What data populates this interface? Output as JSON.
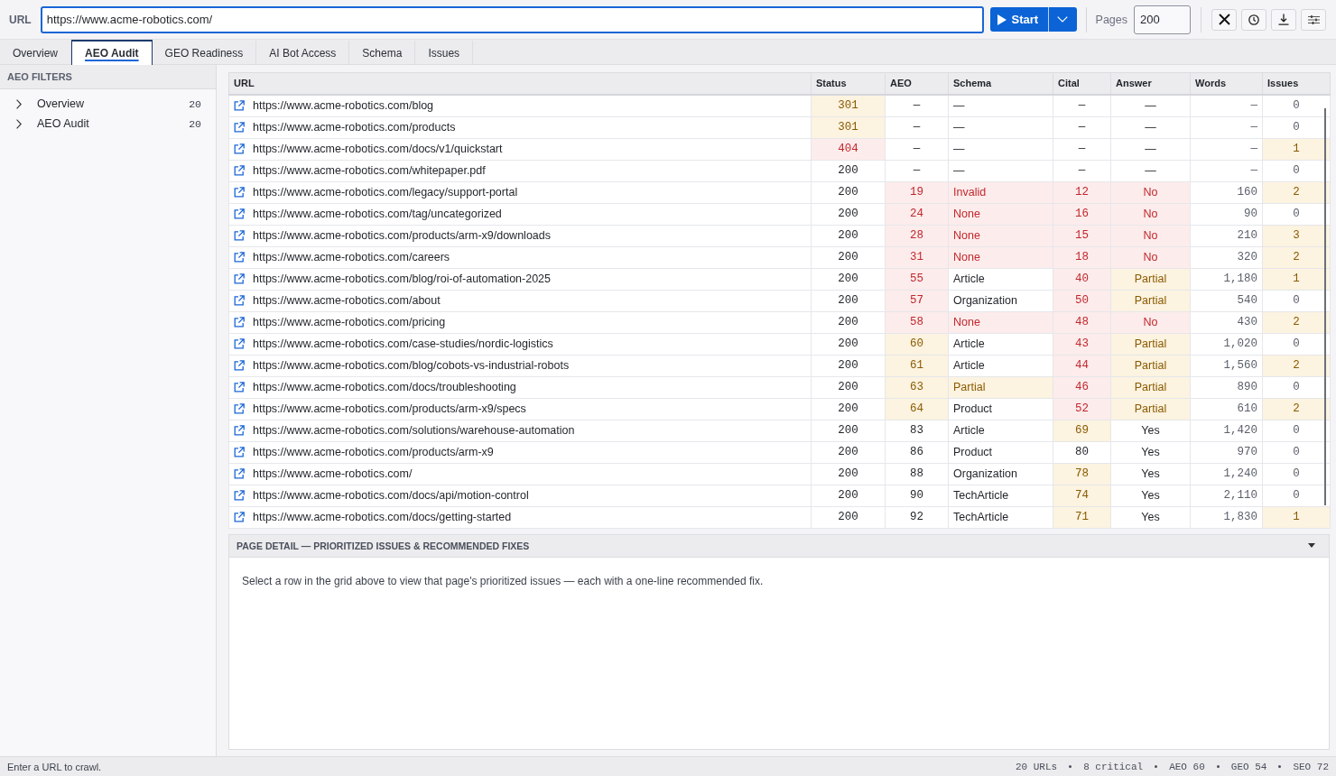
{
  "toolbar": {
    "url_label": "URL",
    "url": "https://www.acme-robotics.com/",
    "start_button": "Start",
    "pages_label": "Pages",
    "pages_value": "200"
  },
  "tabs": [
    {
      "label": "Overview",
      "selected": false
    },
    {
      "label": "AEO Audit",
      "selected": true
    },
    {
      "label": "GEO Readiness",
      "selected": false
    },
    {
      "label": "AI Bot Access",
      "selected": false
    },
    {
      "label": "Schema",
      "selected": false
    },
    {
      "label": "Issues",
      "selected": false
    }
  ],
  "sidebar": {
    "title": "AEO FILTERS",
    "items": [
      {
        "label": "Overview",
        "count": "20",
        "expanded": false
      },
      {
        "label": "AEO Audit",
        "count": "20",
        "expanded": false
      }
    ]
  },
  "table": {
    "columns": [
      "URL",
      "Status",
      "AEO",
      "Schema",
      "Cital",
      "Answer",
      "Words",
      "Issues"
    ],
    "rows": [
      {
        "cells": [
          {
            "text": "https://www.acme-robotics.com/blog",
            "kind": "plain"
          },
          {
            "text": "301",
            "kind": "warning"
          },
          {
            "text": "—",
            "kind": "plain"
          },
          {
            "text": "—",
            "kind": "plain"
          },
          {
            "text": "—",
            "kind": "plain"
          },
          {
            "text": "—",
            "kind": "plain"
          },
          {
            "text": "—",
            "kind": "plain"
          },
          {
            "text": "0",
            "kind": "plain"
          }
        ]
      },
      {
        "cells": [
          {
            "text": "https://www.acme-robotics.com/products",
            "kind": "plain"
          },
          {
            "text": "301",
            "kind": "warning"
          },
          {
            "text": "—",
            "kind": "plain"
          },
          {
            "text": "—",
            "kind": "plain"
          },
          {
            "text": "—",
            "kind": "plain"
          },
          {
            "text": "—",
            "kind": "plain"
          },
          {
            "text": "—",
            "kind": "plain"
          },
          {
            "text": "0",
            "kind": "plain"
          }
        ]
      },
      {
        "cells": [
          {
            "text": "https://www.acme-robotics.com/docs/v1/quickstart",
            "kind": "plain"
          },
          {
            "text": "404",
            "kind": "critical"
          },
          {
            "text": "—",
            "kind": "plain"
          },
          {
            "text": "—",
            "kind": "plain"
          },
          {
            "text": "—",
            "kind": "plain"
          },
          {
            "text": "—",
            "kind": "plain"
          },
          {
            "text": "—",
            "kind": "plain"
          },
          {
            "text": "1",
            "kind": "warning"
          }
        ]
      },
      {
        "cells": [
          {
            "text": "https://www.acme-robotics.com/whitepaper.pdf",
            "kind": "plain"
          },
          {
            "text": "200",
            "kind": "plain"
          },
          {
            "text": "—",
            "kind": "plain"
          },
          {
            "text": "—",
            "kind": "plain"
          },
          {
            "text": "—",
            "kind": "plain"
          },
          {
            "text": "—",
            "kind": "plain"
          },
          {
            "text": "—",
            "kind": "plain"
          },
          {
            "text": "0",
            "kind": "plain"
          }
        ]
      },
      {
        "cells": [
          {
            "text": "https://www.acme-robotics.com/legacy/support-portal",
            "kind": "plain"
          },
          {
            "text": "200",
            "kind": "plain"
          },
          {
            "text": "19",
            "kind": "critical"
          },
          {
            "text": "Invalid",
            "kind": "critical"
          },
          {
            "text": "12",
            "kind": "critical"
          },
          {
            "text": "No",
            "kind": "critical"
          },
          {
            "text": "160",
            "kind": "plain"
          },
          {
            "text": "2",
            "kind": "warning"
          }
        ]
      },
      {
        "cells": [
          {
            "text": "https://www.acme-robotics.com/tag/uncategorized",
            "kind": "plain"
          },
          {
            "text": "200",
            "kind": "plain"
          },
          {
            "text": "24",
            "kind": "critical"
          },
          {
            "text": "None",
            "kind": "critical"
          },
          {
            "text": "16",
            "kind": "critical"
          },
          {
            "text": "No",
            "kind": "critical"
          },
          {
            "text": "90",
            "kind": "plain"
          },
          {
            "text": "0",
            "kind": "plain"
          }
        ]
      },
      {
        "cells": [
          {
            "text": "https://www.acme-robotics.com/products/arm-x9/downloads",
            "kind": "plain"
          },
          {
            "text": "200",
            "kind": "plain"
          },
          {
            "text": "28",
            "kind": "critical"
          },
          {
            "text": "None",
            "kind": "critical"
          },
          {
            "text": "15",
            "kind": "critical"
          },
          {
            "text": "No",
            "kind": "critical"
          },
          {
            "text": "210",
            "kind": "plain"
          },
          {
            "text": "3",
            "kind": "warning"
          }
        ]
      },
      {
        "cells": [
          {
            "text": "https://www.acme-robotics.com/careers",
            "kind": "plain"
          },
          {
            "text": "200",
            "kind": "plain"
          },
          {
            "text": "31",
            "kind": "critical"
          },
          {
            "text": "None",
            "kind": "critical"
          },
          {
            "text": "18",
            "kind": "critical"
          },
          {
            "text": "No",
            "kind": "critical"
          },
          {
            "text": "320",
            "kind": "plain"
          },
          {
            "text": "2",
            "kind": "warning"
          }
        ]
      },
      {
        "cells": [
          {
            "text": "https://www.acme-robotics.com/blog/roi-of-automation-2025",
            "kind": "plain"
          },
          {
            "text": "200",
            "kind": "plain"
          },
          {
            "text": "55",
            "kind": "critical"
          },
          {
            "text": "Article",
            "kind": "plain"
          },
          {
            "text": "40",
            "kind": "critical"
          },
          {
            "text": "Partial",
            "kind": "warning"
          },
          {
            "text": "1,180",
            "kind": "plain"
          },
          {
            "text": "1",
            "kind": "warning"
          }
        ]
      },
      {
        "cells": [
          {
            "text": "https://www.acme-robotics.com/about",
            "kind": "plain"
          },
          {
            "text": "200",
            "kind": "plain"
          },
          {
            "text": "57",
            "kind": "critical"
          },
          {
            "text": "Organization",
            "kind": "plain"
          },
          {
            "text": "50",
            "kind": "critical"
          },
          {
            "text": "Partial",
            "kind": "warning"
          },
          {
            "text": "540",
            "kind": "plain"
          },
          {
            "text": "0",
            "kind": "plain"
          }
        ]
      },
      {
        "cells": [
          {
            "text": "https://www.acme-robotics.com/pricing",
            "kind": "plain"
          },
          {
            "text": "200",
            "kind": "plain"
          },
          {
            "text": "58",
            "kind": "critical"
          },
          {
            "text": "None",
            "kind": "critical"
          },
          {
            "text": "48",
            "kind": "critical"
          },
          {
            "text": "No",
            "kind": "critical"
          },
          {
            "text": "430",
            "kind": "plain"
          },
          {
            "text": "2",
            "kind": "warning"
          }
        ]
      },
      {
        "cells": [
          {
            "text": "https://www.acme-robotics.com/case-studies/nordic-logistics",
            "kind": "plain"
          },
          {
            "text": "200",
            "kind": "plain"
          },
          {
            "text": "60",
            "kind": "warning"
          },
          {
            "text": "Article",
            "kind": "plain"
          },
          {
            "text": "43",
            "kind": "critical"
          },
          {
            "text": "Partial",
            "kind": "warning"
          },
          {
            "text": "1,020",
            "kind": "plain"
          },
          {
            "text": "0",
            "kind": "plain"
          }
        ]
      },
      {
        "cells": [
          {
            "text": "https://www.acme-robotics.com/blog/cobots-vs-industrial-robots",
            "kind": "plain"
          },
          {
            "text": "200",
            "kind": "plain"
          },
          {
            "text": "61",
            "kind": "warning"
          },
          {
            "text": "Article",
            "kind": "plain"
          },
          {
            "text": "44",
            "kind": "critical"
          },
          {
            "text": "Partial",
            "kind": "warning"
          },
          {
            "text": "1,560",
            "kind": "plain"
          },
          {
            "text": "2",
            "kind": "warning"
          }
        ]
      },
      {
        "cells": [
          {
            "text": "https://www.acme-robotics.com/docs/troubleshooting",
            "kind": "plain"
          },
          {
            "text": "200",
            "kind": "plain"
          },
          {
            "text": "63",
            "kind": "warning"
          },
          {
            "text": "Partial",
            "kind": "warning"
          },
          {
            "text": "46",
            "kind": "critical"
          },
          {
            "text": "Partial",
            "kind": "warning"
          },
          {
            "text": "890",
            "kind": "plain"
          },
          {
            "text": "0",
            "kind": "plain"
          }
        ]
      },
      {
        "cells": [
          {
            "text": "https://www.acme-robotics.com/products/arm-x9/specs",
            "kind": "plain"
          },
          {
            "text": "200",
            "kind": "plain"
          },
          {
            "text": "64",
            "kind": "warning"
          },
          {
            "text": "Product",
            "kind": "plain"
          },
          {
            "text": "52",
            "kind": "critical"
          },
          {
            "text": "Partial",
            "kind": "warning"
          },
          {
            "text": "610",
            "kind": "plain"
          },
          {
            "text": "2",
            "kind": "warning"
          }
        ]
      },
      {
        "cells": [
          {
            "text": "https://www.acme-robotics.com/solutions/warehouse-automation",
            "kind": "plain"
          },
          {
            "text": "200",
            "kind": "plain"
          },
          {
            "text": "83",
            "kind": "plain"
          },
          {
            "text": "Article",
            "kind": "plain"
          },
          {
            "text": "69",
            "kind": "warning"
          },
          {
            "text": "Yes",
            "kind": "plain"
          },
          {
            "text": "1,420",
            "kind": "plain"
          },
          {
            "text": "0",
            "kind": "plain"
          }
        ]
      },
      {
        "cells": [
          {
            "text": "https://www.acme-robotics.com/products/arm-x9",
            "kind": "plain"
          },
          {
            "text": "200",
            "kind": "plain"
          },
          {
            "text": "86",
            "kind": "plain"
          },
          {
            "text": "Product",
            "kind": "plain"
          },
          {
            "text": "80",
            "kind": "plain"
          },
          {
            "text": "Yes",
            "kind": "plain"
          },
          {
            "text": "970",
            "kind": "plain"
          },
          {
            "text": "0",
            "kind": "plain"
          }
        ]
      },
      {
        "cells": [
          {
            "text": "https://www.acme-robotics.com/",
            "kind": "plain"
          },
          {
            "text": "200",
            "kind": "plain"
          },
          {
            "text": "88",
            "kind": "plain"
          },
          {
            "text": "Organization",
            "kind": "plain"
          },
          {
            "text": "78",
            "kind": "warning"
          },
          {
            "text": "Yes",
            "kind": "plain"
          },
          {
            "text": "1,240",
            "kind": "plain"
          },
          {
            "text": "0",
            "kind": "plain"
          }
        ]
      },
      {
        "cells": [
          {
            "text": "https://www.acme-robotics.com/docs/api/motion-control",
            "kind": "plain"
          },
          {
            "text": "200",
            "kind": "plain"
          },
          {
            "text": "90",
            "kind": "plain"
          },
          {
            "text": "TechArticle",
            "kind": "plain"
          },
          {
            "text": "74",
            "kind": "warning"
          },
          {
            "text": "Yes",
            "kind": "plain"
          },
          {
            "text": "2,110",
            "kind": "plain"
          },
          {
            "text": "0",
            "kind": "plain"
          }
        ]
      },
      {
        "cells": [
          {
            "text": "https://www.acme-robotics.com/docs/getting-started",
            "kind": "plain"
          },
          {
            "text": "200",
            "kind": "plain"
          },
          {
            "text": "92",
            "kind": "plain"
          },
          {
            "text": "TechArticle",
            "kind": "plain"
          },
          {
            "text": "71",
            "kind": "warning"
          },
          {
            "text": "Yes",
            "kind": "plain"
          },
          {
            "text": "1,830",
            "kind": "plain"
          },
          {
            "text": "1",
            "kind": "warning"
          }
        ]
      }
    ]
  },
  "detail_panel": {
    "title": "PAGE DETAIL — PRIORITIZED ISSUES & RECOMMENDED FIXES",
    "expanded": true,
    "message": "Select a row in the grid above to view that page's prioritized issues — each with a one-line recommended fix."
  },
  "status_bar": {
    "message": "Enter a URL to crawl.",
    "stats": [
      "20 URLs",
      "8 critical",
      "AEO 60",
      "GEO 54",
      "SEO 72"
    ]
  }
}
